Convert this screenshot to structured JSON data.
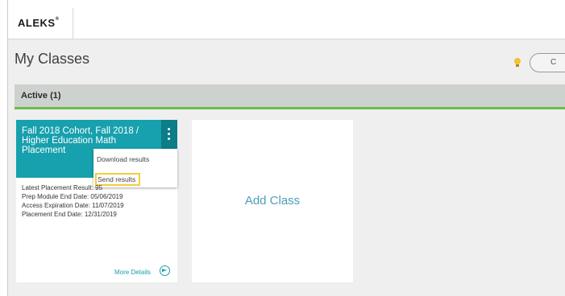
{
  "header": {
    "logo": "ALEKS",
    "logo_mark": "®"
  },
  "page": {
    "title": "My Classes",
    "pill_text": "C"
  },
  "section": {
    "title": "Active (1)"
  },
  "class_card": {
    "title": "Fall 2018 Cohort, Fall 2018 / Higher Education Math Placement",
    "menu": {
      "items": [
        "Download results",
        "Send results"
      ]
    },
    "details": [
      "Latest Placement Result: 95",
      "Prep Module End Date: 05/06/2019",
      "Access Expiration Date: 11/07/2019",
      "Placement End Date: 12/31/2019"
    ],
    "more_details": "More Details"
  },
  "add_card": {
    "label": "Add Class"
  },
  "colors": {
    "teal": "#17a0ad",
    "teal_dark": "#0d7d88",
    "green": "#6abf4b",
    "highlight": "#f1cd3c"
  },
  "icons": [
    "lightbulb-icon",
    "kebab-menu-icon",
    "arrow-circle-right-icon"
  ]
}
